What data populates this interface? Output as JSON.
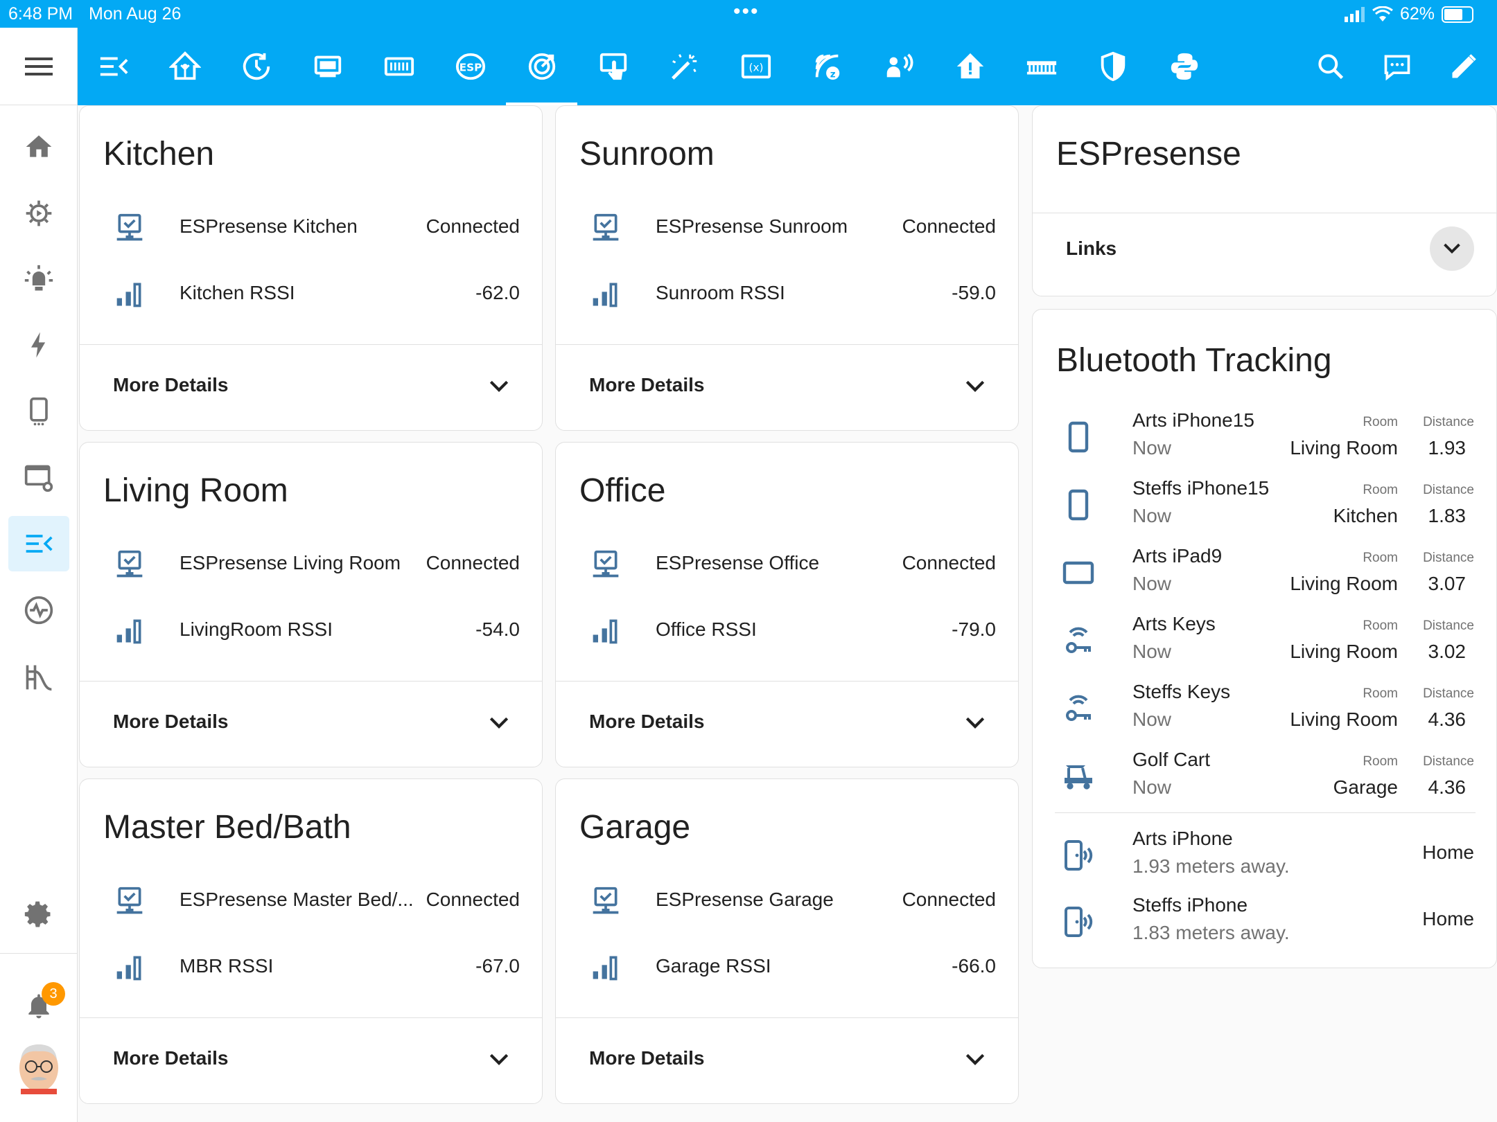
{
  "status_bar": {
    "time": "6:48 PM",
    "date": "Mon Aug 26",
    "battery": "62%"
  },
  "toolbar": {
    "tabs": [
      "menu-lines-icon",
      "home-assistant-icon",
      "clock-icon",
      "server-icon",
      "keyboard-board-icon",
      "esp-icon",
      "target-icon",
      "touch-icon",
      "magic-wand-icon",
      "variable-icon",
      "zigbee-icon",
      "person-broadcast-icon",
      "home-alert-icon",
      "comb-icon",
      "shield-icon",
      "python-icon"
    ],
    "active_tab": 6,
    "actions": [
      "search-icon",
      "assist-icon",
      "edit-icon"
    ]
  },
  "sidebar": {
    "items": [
      "home-icon",
      "cog-play-icon",
      "light-icon",
      "energy-icon",
      "tablet-icon",
      "monitor-cog-icon",
      "menu-lines-icon",
      "pulse-icon",
      "playground-slide-icon"
    ],
    "active_index": 6,
    "settings": "cog-icon",
    "notifications": {
      "count": "3"
    }
  },
  "cards": [
    {
      "title": "Kitchen",
      "node": "ESPresense Kitchen",
      "status": "Connected",
      "rssi_label": "Kitchen RSSI",
      "rssi": "-62.0",
      "more": "More Details"
    },
    {
      "title": "Sunroom",
      "node": "ESPresense Sunroom",
      "status": "Connected",
      "rssi_label": "Sunroom RSSI",
      "rssi": "-59.0",
      "more": "More Details"
    },
    {
      "title": "Living Room",
      "node": "ESPresense Living Room",
      "status": "Connected",
      "rssi_label": "LivingRoom RSSI",
      "rssi": "-54.0",
      "more": "More Details"
    },
    {
      "title": "Office",
      "node": "ESPresense Office",
      "status": "Connected",
      "rssi_label": "Office RSSI",
      "rssi": "-79.0",
      "more": "More Details"
    },
    {
      "title": "Master Bed/Bath",
      "node": "ESPresense Master Bed/...",
      "status": "Connected",
      "rssi_label": "MBR RSSI",
      "rssi": "-67.0",
      "more": "More Details"
    },
    {
      "title": "Garage",
      "node": "ESPresense Garage",
      "status": "Connected",
      "rssi_label": "Garage RSSI",
      "rssi": "-66.0",
      "more": "More Details"
    }
  ],
  "espresense": {
    "title": "ESPresense",
    "links_label": "Links"
  },
  "bluetooth": {
    "title": "Bluetooth Tracking",
    "room_label": "Room",
    "distance_label": "Distance",
    "devices": [
      {
        "name": "Arts iPhone15",
        "time": "Now",
        "room": "Living Room",
        "distance": "1.93",
        "icon": "cellphone-icon"
      },
      {
        "name": "Steffs iPhone15",
        "time": "Now",
        "room": "Kitchen",
        "distance": "1.83",
        "icon": "cellphone-icon"
      },
      {
        "name": "Arts iPad9",
        "time": "Now",
        "room": "Living Room",
        "distance": "3.07",
        "icon": "tablet-icon"
      },
      {
        "name": "Arts Keys",
        "time": "Now",
        "room": "Living Room",
        "distance": "3.02",
        "icon": "key-wireless-icon"
      },
      {
        "name": "Steffs Keys",
        "time": "Now",
        "room": "Living Room",
        "distance": "4.36",
        "icon": "key-wireless-icon"
      },
      {
        "name": "Golf Cart",
        "time": "Now",
        "room": "Garage",
        "distance": "4.36",
        "icon": "golf-cart-icon"
      }
    ],
    "trackers": [
      {
        "name": "Arts iPhone",
        "detail": "1.93 meters away.",
        "state": "Home",
        "icon": "cellphone-wireless-icon"
      },
      {
        "name": "Steffs iPhone",
        "detail": "1.83 meters away.",
        "state": "Home",
        "icon": "cellphone-wireless-icon"
      }
    ]
  },
  "colors": {
    "primary": "#03a9f4",
    "icon": "#44739e",
    "sidebar_icon": "#727272",
    "badge": "#ff9800"
  }
}
